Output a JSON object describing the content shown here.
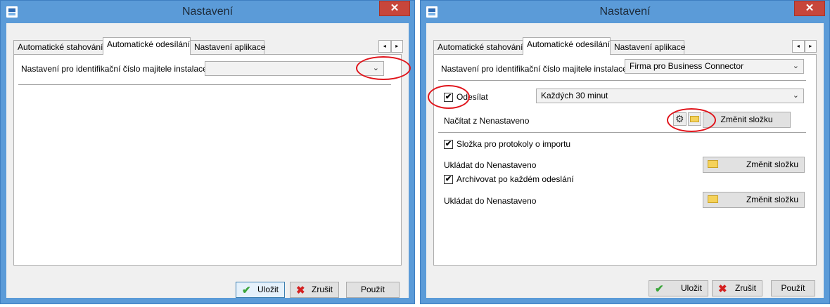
{
  "left_window": {
    "title": "Nastavení",
    "close_glyph": "✕",
    "tabs": [
      "Automatické stahování",
      "Automatické odesílání",
      "Nastavení aplikace"
    ],
    "active_tab_index": 1,
    "owner_id_label": "Nastavení pro identifikační číslo majitele instalace",
    "owner_id_value": "",
    "buttons": {
      "save": "Uložit",
      "cancel": "Zrušit",
      "apply": "Použít"
    }
  },
  "right_window": {
    "title": "Nastavení",
    "close_glyph": "✕",
    "tabs": [
      "Automatické stahování",
      "Automatické odesílání",
      "Nastavení aplikace"
    ],
    "active_tab_index": 1,
    "owner_id_label": "Nastavení pro identifikační číslo majitele instalace",
    "owner_id_value": "Firma pro Business Connector",
    "send_label": "Odesílat",
    "send_checked": true,
    "send_interval": "Každých 30 minut",
    "load_from_label": "Načítat z Nenastaveno",
    "change_folder_label": "Změnit složku",
    "import_log_label": "Složka pro protokoly o importu",
    "import_log_checked": true,
    "save_to_label_1": "Ukládat do Nenastaveno",
    "archive_label": "Archivovat po každém odeslání",
    "archive_checked": true,
    "save_to_label_2": "Ukládat do Nenastaveno",
    "buttons": {
      "save": "Uložit",
      "cancel": "Zrušit",
      "apply": "Použít"
    }
  },
  "icons": {
    "chevron": "⌄",
    "check": "✔",
    "cross": "✖",
    "gear": "⚙",
    "arrow_left": "◂",
    "arrow_right": "▸"
  },
  "colors": {
    "frame": "#5b9bd8",
    "close": "#c7463b",
    "annotation": "#e0141b",
    "check_green": "#3aa53a",
    "cross_red": "#d42020"
  }
}
